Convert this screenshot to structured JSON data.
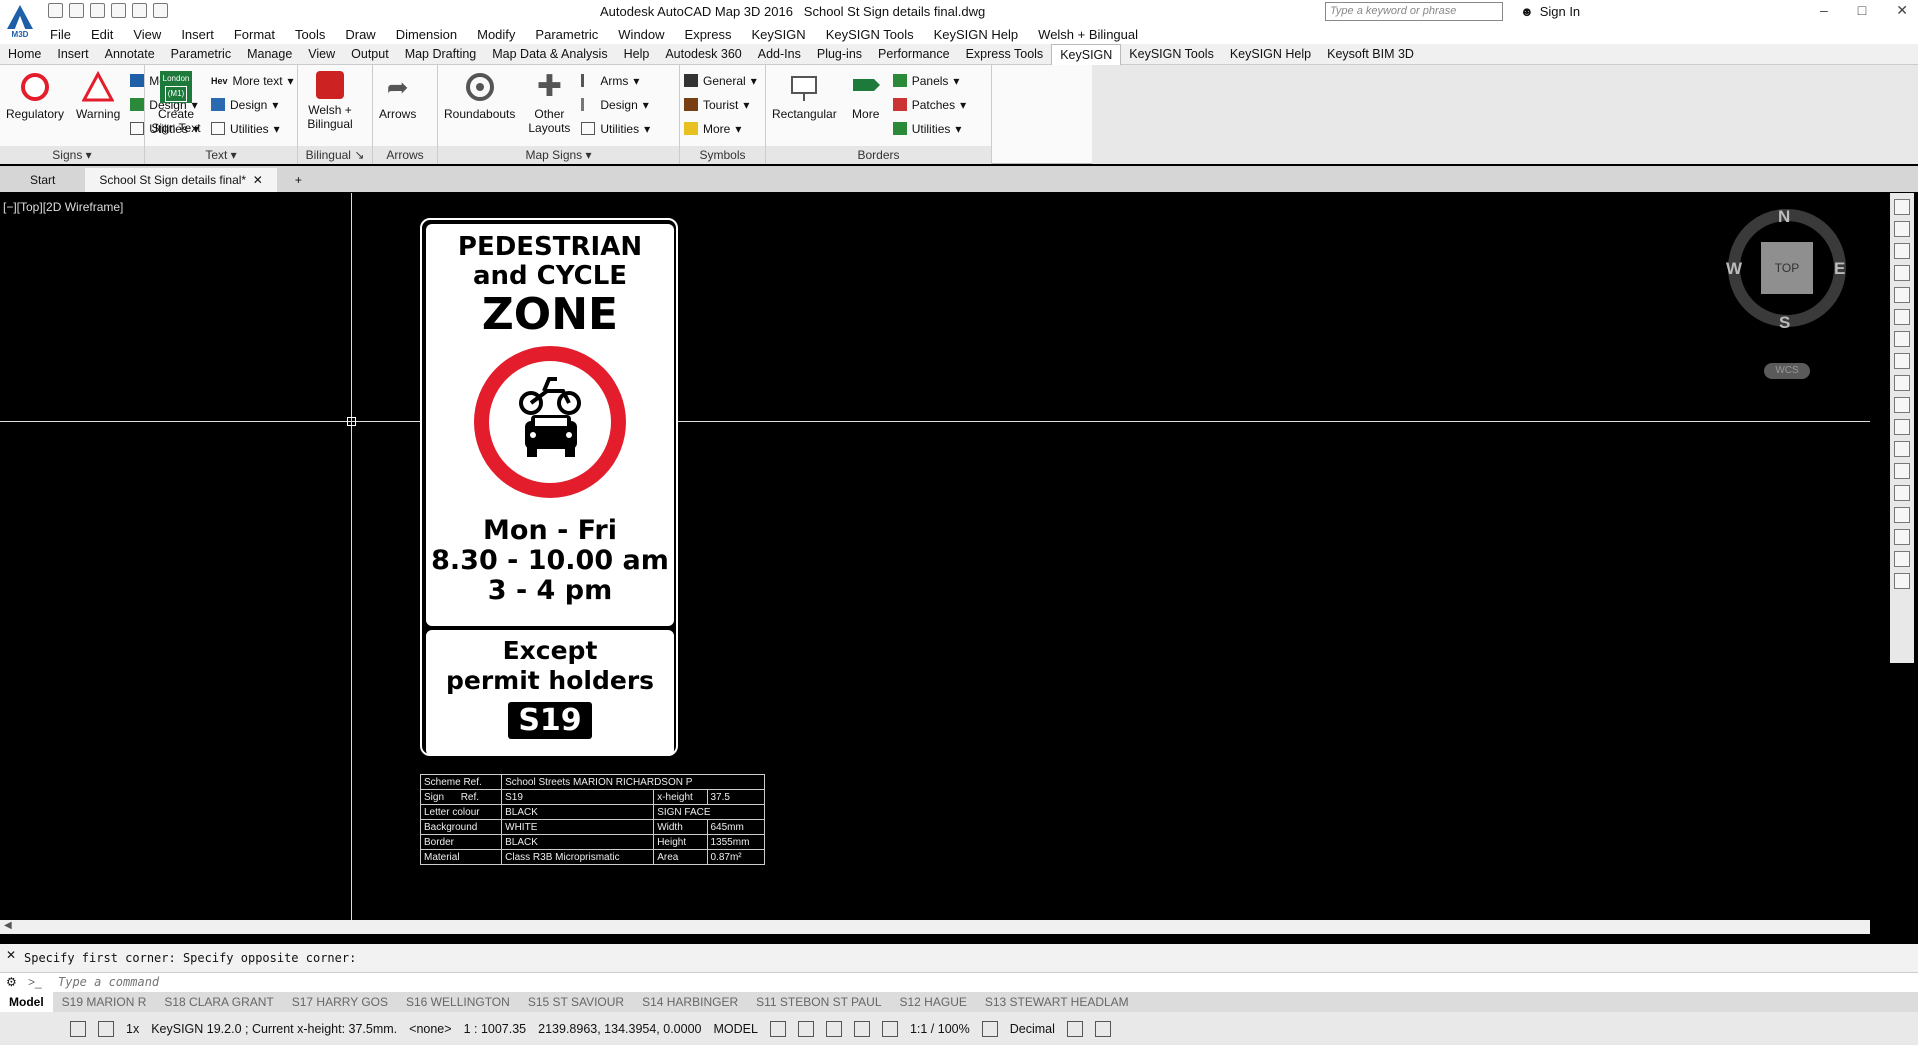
{
  "app": {
    "logo_label": "M3D",
    "title": "Autodesk AutoCAD Map 3D 2016",
    "document": "School St Sign details final.dwg",
    "search_placeholder": "Type a keyword or phrase",
    "sign_in": "Sign In"
  },
  "menu": [
    "File",
    "Edit",
    "View",
    "Insert",
    "Format",
    "Tools",
    "Draw",
    "Dimension",
    "Modify",
    "Parametric",
    "Window",
    "Express",
    "KeySIGN",
    "KeySIGN Tools",
    "KeySIGN Help",
    "Welsh + Bilingual"
  ],
  "ribbon_tabs": [
    "Home",
    "Insert",
    "Annotate",
    "Parametric",
    "Manage",
    "View",
    "Output",
    "Map Drafting",
    "Map Data & Analysis",
    "Help",
    "Autodesk 360",
    "Add-Ins",
    "Plug-ins",
    "Performance",
    "Express Tools",
    "KeySIGN",
    "KeySIGN Tools",
    "KeySIGN Help",
    "Keysoft BIM 3D"
  ],
  "active_ribbon_tab": "KeySIGN",
  "ribbon": {
    "signs": {
      "title": "Signs",
      "regulatory": "Regulatory",
      "warning": "Warning",
      "more": "More",
      "design": "Design",
      "utilities": "Utilities"
    },
    "text": {
      "title": "Text",
      "create": "Create Sign Text",
      "more_text": "More text",
      "design": "Design",
      "utilities": "Utilities",
      "hev": "Hev",
      "london": "London",
      "m1": "(M1)"
    },
    "bilingual": {
      "title": "Bilingual",
      "welsh": "Welsh + Bilingual"
    },
    "arrows": {
      "title": "Arrows",
      "arrows": "Arrows"
    },
    "map_signs": {
      "title": "Map Signs",
      "roundabouts": "Roundabouts",
      "other": "Other Layouts",
      "arms": "Arms",
      "design": "Design",
      "utilities": "Utilities"
    },
    "symbols": {
      "title": "Symbols",
      "general": "General",
      "tourist": "Tourist",
      "more": "More"
    },
    "borders": {
      "title": "Borders",
      "rectangular": "Rectangular",
      "more": "More",
      "panels": "Panels",
      "patches": "Patches",
      "utilities": "Utilities"
    }
  },
  "doc_tabs": {
    "start": "Start",
    "active": "School St Sign details final*"
  },
  "viewport": {
    "label": "[−][Top][2D Wireframe]"
  },
  "sign": {
    "line1": "PEDESTRIAN",
    "line2": "and CYCLE",
    "line3": "ZONE",
    "days": "Mon - Fri",
    "time1": "8.30 - 10.00 am",
    "time2": "3 - 4 pm",
    "except1": "Except",
    "except2": "permit holders",
    "code": "S19"
  },
  "info_table": {
    "scheme_label": "Scheme Ref.",
    "scheme_value": "School Streets MARION RICHARDSON P",
    "sign_label": "Sign",
    "sign_ref": "Ref.",
    "sign_value": "S19",
    "xheight_label": "x-height",
    "xheight_value": "37.5",
    "letter_label": "Letter colour",
    "letter_value": "BLACK",
    "face_label": "SIGN FACE",
    "bg_label": "Background",
    "bg_value": "WHITE",
    "width_label": "Width",
    "width_value": "645mm",
    "border_label": "Border",
    "border_value": "BLACK",
    "height_label": "Height",
    "height_value": "1355mm",
    "material_label": "Material",
    "material_value": "Class R3B Microprismatic",
    "area_label": "Area",
    "area_value": "0.87m²"
  },
  "viewcube": {
    "n": "N",
    "s": "S",
    "e": "E",
    "w": "W",
    "top": "TOP",
    "wcs": "WCS"
  },
  "command": {
    "history": "Specify first corner: Specify opposite corner:",
    "placeholder": "Type a command"
  },
  "layout_tabs": [
    "Model",
    "S19 MARION R",
    "S18 CLARA GRANT",
    "S17 HARRY GOS",
    "S16 WELLINGTON",
    "S15 ST SAVIOUR",
    "S14 HARBINGER",
    "S11 STEBON ST PAUL",
    "S12 HAGUE",
    "S13 STEWART HEADLAM"
  ],
  "status": {
    "scale_x": "1x",
    "keysign": "KeySIGN 19.2.0 ;  Current x-height: 37.5mm.",
    "layer": "<none>",
    "scale": "1 : 1007.35",
    "coords": "2139.8963, 134.3954, 0.0000",
    "mode": "MODEL",
    "annot_scale": "1:1 / 100%",
    "units": "Decimal"
  },
  "colors": {
    "accent": "#1f5fa8",
    "roundel_red": "#e31d2b",
    "ribbon_bg": "#fafafa",
    "viewport_bg": "#000000"
  }
}
